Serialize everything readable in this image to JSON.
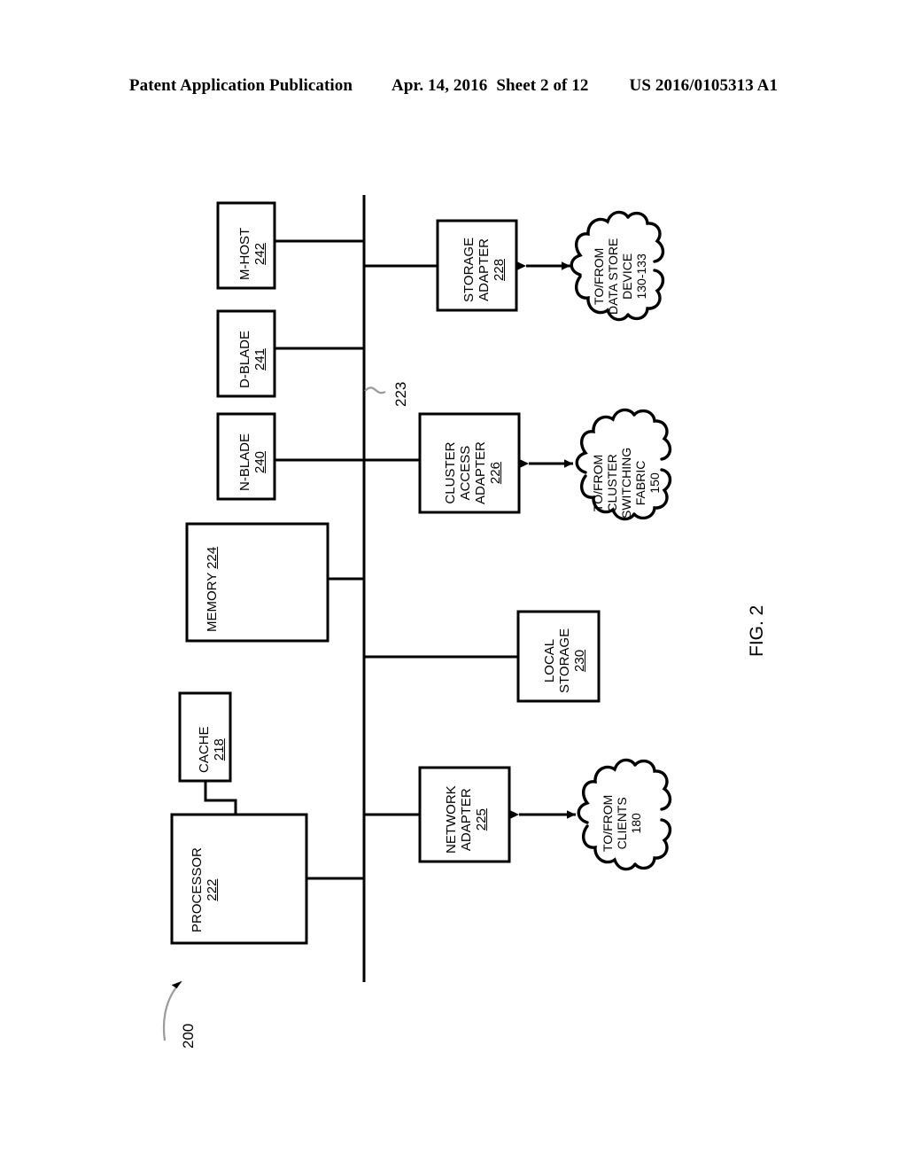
{
  "header": {
    "publication": "Patent Application Publication",
    "date": "Apr. 14, 2016",
    "sheet": "Sheet 2 of 12",
    "number": "US 2016/0105313 A1"
  },
  "figure": {
    "figure_label": "FIG. 2",
    "system_ref": "200",
    "bus_ref": "223",
    "boxes": [
      {
        "id": "m-host",
        "title": "M-HOST",
        "ref": "242"
      },
      {
        "id": "d-blade",
        "title": "D-BLADE",
        "ref": "241"
      },
      {
        "id": "n-blade",
        "title": "N-BLADE",
        "ref": "240"
      },
      {
        "id": "memory",
        "title": "MEMORY",
        "ref": "224"
      },
      {
        "id": "cache",
        "title": "CACHE",
        "ref": "218"
      },
      {
        "id": "processor",
        "title": "PROCESSOR",
        "ref": "222"
      },
      {
        "id": "storage-adapter",
        "title": "STORAGE\nADAPTER",
        "ref": "228"
      },
      {
        "id": "cluster-access-adapter",
        "title": "CLUSTER\nACCESS\nADAPTER",
        "ref": "226"
      },
      {
        "id": "local-storage",
        "title": "LOCAL\nSTORAGE",
        "ref": "230"
      },
      {
        "id": "network-adapter",
        "title": "NETWORK\nADAPTER",
        "ref": "225"
      }
    ],
    "box_labels": {
      "m_host_line1": "M-HOST",
      "m_host_ref": "242",
      "d_blade_line1": "D-BLADE",
      "d_blade_ref": "241",
      "n_blade_line1": "N-BLADE",
      "n_blade_ref": "240",
      "memory_line1": "MEMORY",
      "memory_ref": "224",
      "cache_line1": "CACHE",
      "cache_ref": "218",
      "processor_line1": "PROCESSOR",
      "processor_ref": "222",
      "storage_adapter_line1": "STORAGE",
      "storage_adapter_line2": "ADAPTER",
      "storage_adapter_ref": "228",
      "cluster_adapter_line1": "CLUSTER",
      "cluster_adapter_line2": "ACCESS",
      "cluster_adapter_line3": "ADAPTER",
      "cluster_adapter_ref": "226",
      "local_storage_line1": "LOCAL",
      "local_storage_line2": "STORAGE",
      "local_storage_ref": "230",
      "network_adapter_line1": "NETWORK",
      "network_adapter_line2": "ADAPTER",
      "network_adapter_ref": "225"
    },
    "clouds": {
      "data_store": {
        "line1": "TO/FROM",
        "line2": "DATA STORE",
        "line3": "DEVICE",
        "line4": "130-133"
      },
      "cluster_fabric": {
        "line1": "TO/FROM",
        "line2": "CLUSTER",
        "line3": "SWITCHING",
        "line4": "FABRIC",
        "line5": "150"
      },
      "clients": {
        "line1": "TO/FROM",
        "line2": "CLIENTS",
        "line3": "180"
      }
    }
  },
  "colors": {
    "ink": "#000000",
    "paper": "#ffffff",
    "leader": "#999999"
  }
}
